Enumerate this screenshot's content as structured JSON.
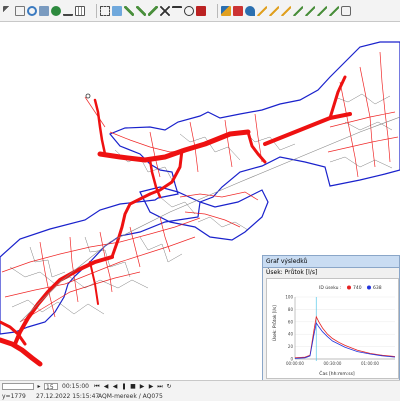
{
  "chart_window": {
    "title": "Graf výsledků",
    "tab": "Úsek: Průtok [l/s]",
    "legend_title": "ID úseku :",
    "legend_items": [
      {
        "label": "740",
        "color": "#e52222"
      },
      {
        "label": "638",
        "color": "#2233dd"
      }
    ],
    "y_label": "Úsek: Průtok [l/s]",
    "x_label": "Čas [hh:mm:ss]"
  },
  "chart_data": {
    "type": "line",
    "xlabel": "Čas [hh:mm:ss]",
    "ylabel": "Úsek: Průtok [l/s]",
    "x_ticks": [
      "00:00:00",
      "00:30:00",
      "01:00:00"
    ],
    "y_ticks": [
      0,
      20,
      40,
      60,
      80,
      100
    ],
    "xlim": [
      0,
      80
    ],
    "ylim": [
      0,
      100
    ],
    "marker_x": 17,
    "series": [
      {
        "name": "740",
        "color": "#e52222",
        "x": [
          0,
          8,
          12,
          15,
          17,
          19,
          22,
          26,
          30,
          35,
          40,
          50,
          60,
          70,
          80
        ],
        "y": [
          2,
          3,
          6,
          45,
          68,
          60,
          50,
          40,
          33,
          27,
          22,
          14,
          9,
          6,
          4
        ]
      },
      {
        "name": "638",
        "color": "#2233dd",
        "x": [
          0,
          8,
          12,
          15,
          17,
          19,
          22,
          26,
          30,
          35,
          40,
          50,
          60,
          70,
          80
        ],
        "y": [
          1,
          2,
          5,
          38,
          58,
          52,
          44,
          36,
          29,
          24,
          19,
          12,
          8,
          5,
          3
        ]
      }
    ]
  },
  "playback": {
    "step_field": "",
    "step_value": "15",
    "time_value": "00:15:00"
  },
  "status": {
    "coords": "y=1779",
    "datetime": "27.12.2022 15:15:47",
    "project": "AQM-mereek / AQ075"
  },
  "colors": {
    "network_red": "#ee1111",
    "boundary_blue": "#1a22cc"
  }
}
